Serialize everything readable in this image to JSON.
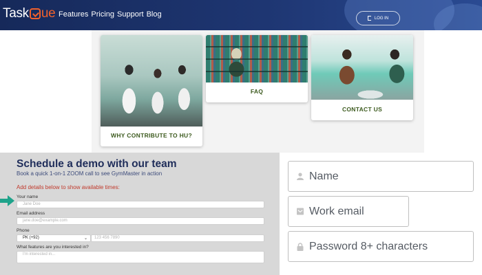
{
  "brand": {
    "logo_text": "TaskQue"
  },
  "nav": {
    "links": [
      "Features",
      "Pricing",
      "Support",
      "Blog"
    ],
    "login_label": "LOG IN"
  },
  "cards": [
    {
      "label": "WHY CONTRIBUTE TO HU?",
      "image": "lab-photo"
    },
    {
      "label": "FAQ",
      "image": "library-photo"
    },
    {
      "label": "CONTACT US",
      "image": "study-photo"
    }
  ],
  "demo": {
    "title": "Schedule a demo with our team",
    "subtitle": "Book a quick 1-on-1 ZOOM call to see GymMaster in action",
    "instruction": "Add details below to show available times:",
    "name_label": "Your name",
    "name_placeholder": "Jane Doe",
    "email_label": "Email address",
    "email_placeholder": "jane.doe@example.com",
    "phone_label": "Phone",
    "country_code": "PK (+92)",
    "phone_placeholder": "123 456 7890",
    "features_label": "What features are you interested in?",
    "features_placeholder": "I'm interested in..."
  },
  "signup": {
    "name_placeholder": "Name",
    "email_placeholder": "Work email",
    "password_placeholder": "Password 8+ characters"
  },
  "colors": {
    "nav_bg": "#1e3672",
    "logo_accent": "#f0612c",
    "card_label": "#3c5a1e",
    "demo_title": "#1f2d5a",
    "instruction": "#c0392b",
    "arrow": "#1fa38b"
  },
  "icons": {
    "name": "person-icon",
    "email": "envelope-icon",
    "password": "lock-icon",
    "login": "door-icon"
  }
}
